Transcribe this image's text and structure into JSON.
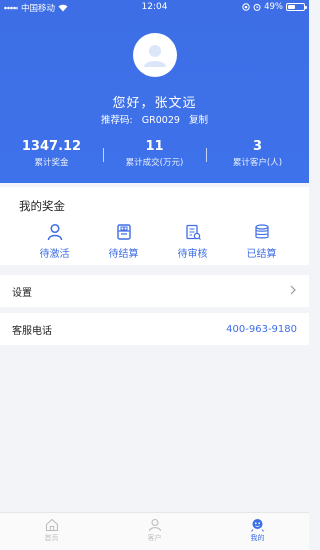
{
  "status_bar": {
    "carrier": "中国移动",
    "time": "12:04",
    "battery": "49%",
    "battery_level": 0.49
  },
  "profile": {
    "greeting": "您好，张文远",
    "referral_label": "推荐码:",
    "referral_code": "GR0029",
    "copy_label": "复制"
  },
  "stats": [
    {
      "value": "1347.12",
      "label": "累计奖金"
    },
    {
      "value": "11",
      "label": "累计成交(万元)"
    },
    {
      "value": "3",
      "label": "累计客户(人)"
    }
  ],
  "bonus": {
    "title": "我的奖金",
    "items": [
      {
        "label": "待激活",
        "icon": "person-icon"
      },
      {
        "label": "待结算",
        "icon": "wallet-icon"
      },
      {
        "label": "待审核",
        "icon": "clipboard-icon"
      },
      {
        "label": "已结算",
        "icon": "coins-icon"
      }
    ]
  },
  "settings": {
    "label": "设置"
  },
  "service": {
    "label": "客服电话",
    "phone": "400-963-9180"
  },
  "tabs": [
    {
      "label": "首页",
      "icon": "home-icon"
    },
    {
      "label": "客户",
      "icon": "customer-icon"
    },
    {
      "label": "我的",
      "icon": "mine-icon",
      "active": true
    }
  ],
  "colors": {
    "primary": "#3d6ee6",
    "background": "#f3f4f7"
  }
}
